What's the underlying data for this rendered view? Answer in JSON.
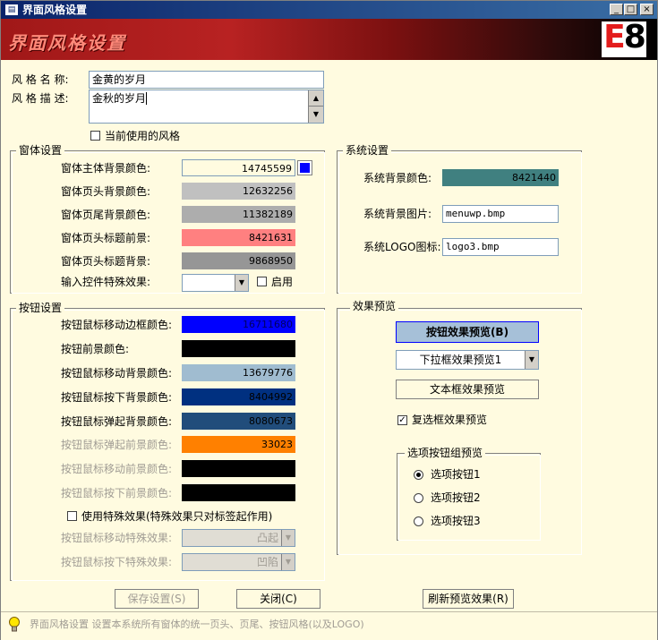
{
  "window": {
    "title": "界面风格设置"
  },
  "banner": {
    "title": "界面风格设置",
    "logo": "E8"
  },
  "style": {
    "name_label": "风 格 名 称:",
    "name_value": "金黄的岁月",
    "desc_label": "风 格 描 述:",
    "desc_value": "金秋的岁月",
    "current_style_label": "当前使用的风格"
  },
  "window_group": {
    "title": "窗体设置",
    "rows": [
      {
        "label": "窗体主体背景颜色:",
        "value": "14745599",
        "color": "#fffbe0"
      },
      {
        "label": "窗体页头背景颜色:",
        "value": "12632256",
        "color": "#c0c0c0"
      },
      {
        "label": "窗体页尾背景颜色:",
        "value": "11382189",
        "color": "#adadad"
      },
      {
        "label": "窗体页头标题前景:",
        "value": "8421631",
        "color": "#ff8080"
      },
      {
        "label": "窗体页头标题背景:",
        "value": "9868950",
        "color": "#969696"
      }
    ],
    "effect_label": "输入控件特殊效果:",
    "enable_label": "启用",
    "main_bg_swatch": "#0000ff"
  },
  "system_group": {
    "title": "系统设置",
    "bg_color_label": "系统背景颜色:",
    "bg_color_value": "8421440",
    "bg_color": "#408080",
    "bg_image_label": "系统背景图片:",
    "bg_image_value": "menuwp.bmp",
    "logo_label": "系统LOGO图标:",
    "logo_value": "logo3.bmp"
  },
  "button_group": {
    "title": "按钮设置",
    "rows": [
      {
        "label": "按钮鼠标移动边框颜色:",
        "value": "16711680",
        "color": "#0000ff",
        "text_color": "#000060",
        "disabled": false
      },
      {
        "label": "按钮前景颜色:",
        "value": "",
        "color": "#000000",
        "text_color": "#000",
        "disabled": false
      },
      {
        "label": "按钮鼠标移动背景颜色:",
        "value": "13679776",
        "color": "#a0bcd0",
        "text_color": "#000",
        "disabled": false
      },
      {
        "label": "按钮鼠标按下背景颜色:",
        "value": "8404992",
        "color": "#003080",
        "text_color": "#000",
        "disabled": false
      },
      {
        "label": "按钮鼠标弹起背景颜色:",
        "value": "8080673",
        "color": "#214d7b",
        "text_color": "#000",
        "disabled": false
      },
      {
        "label": "按钮鼠标弹起前景颜色:",
        "value": "33023",
        "color": "#ff8000",
        "text_color": "#000",
        "disabled": true
      },
      {
        "label": "按钮鼠标移动前景颜色:",
        "value": "",
        "color": "#000000",
        "text_color": "#000",
        "disabled": true
      },
      {
        "label": "按钮鼠标按下前景颜色:",
        "value": "",
        "color": "#000000",
        "text_color": "#000",
        "disabled": true
      }
    ],
    "special_effect_label": "使用特殊效果(特殊效果只对标签起作用)",
    "move_effect_label": "按钮鼠标移动特殊效果:",
    "move_effect_value": "凸起",
    "press_effect_label": "按钮鼠标按下特殊效果:",
    "press_effect_value": "凹陷"
  },
  "preview_group": {
    "title": "效果预览",
    "button_preview": "按钮效果预览(B)",
    "combo_preview": "下拉框效果预览1",
    "textbox_preview": "文本框效果预览",
    "checkbox_preview": "复选框效果预览",
    "radio_group_title": "选项按钮组预览",
    "radios": [
      "选项按钮1",
      "选项按钮2",
      "选项按钮3"
    ]
  },
  "buttons": {
    "save": "保存设置(S)",
    "close": "关闭(C)",
    "refresh": "刷新预览效果(R)"
  },
  "status": {
    "text": "界面风格设置  设置本系统所有窗体的统一页头、页尾、按钮风格(以及LOGO)"
  }
}
